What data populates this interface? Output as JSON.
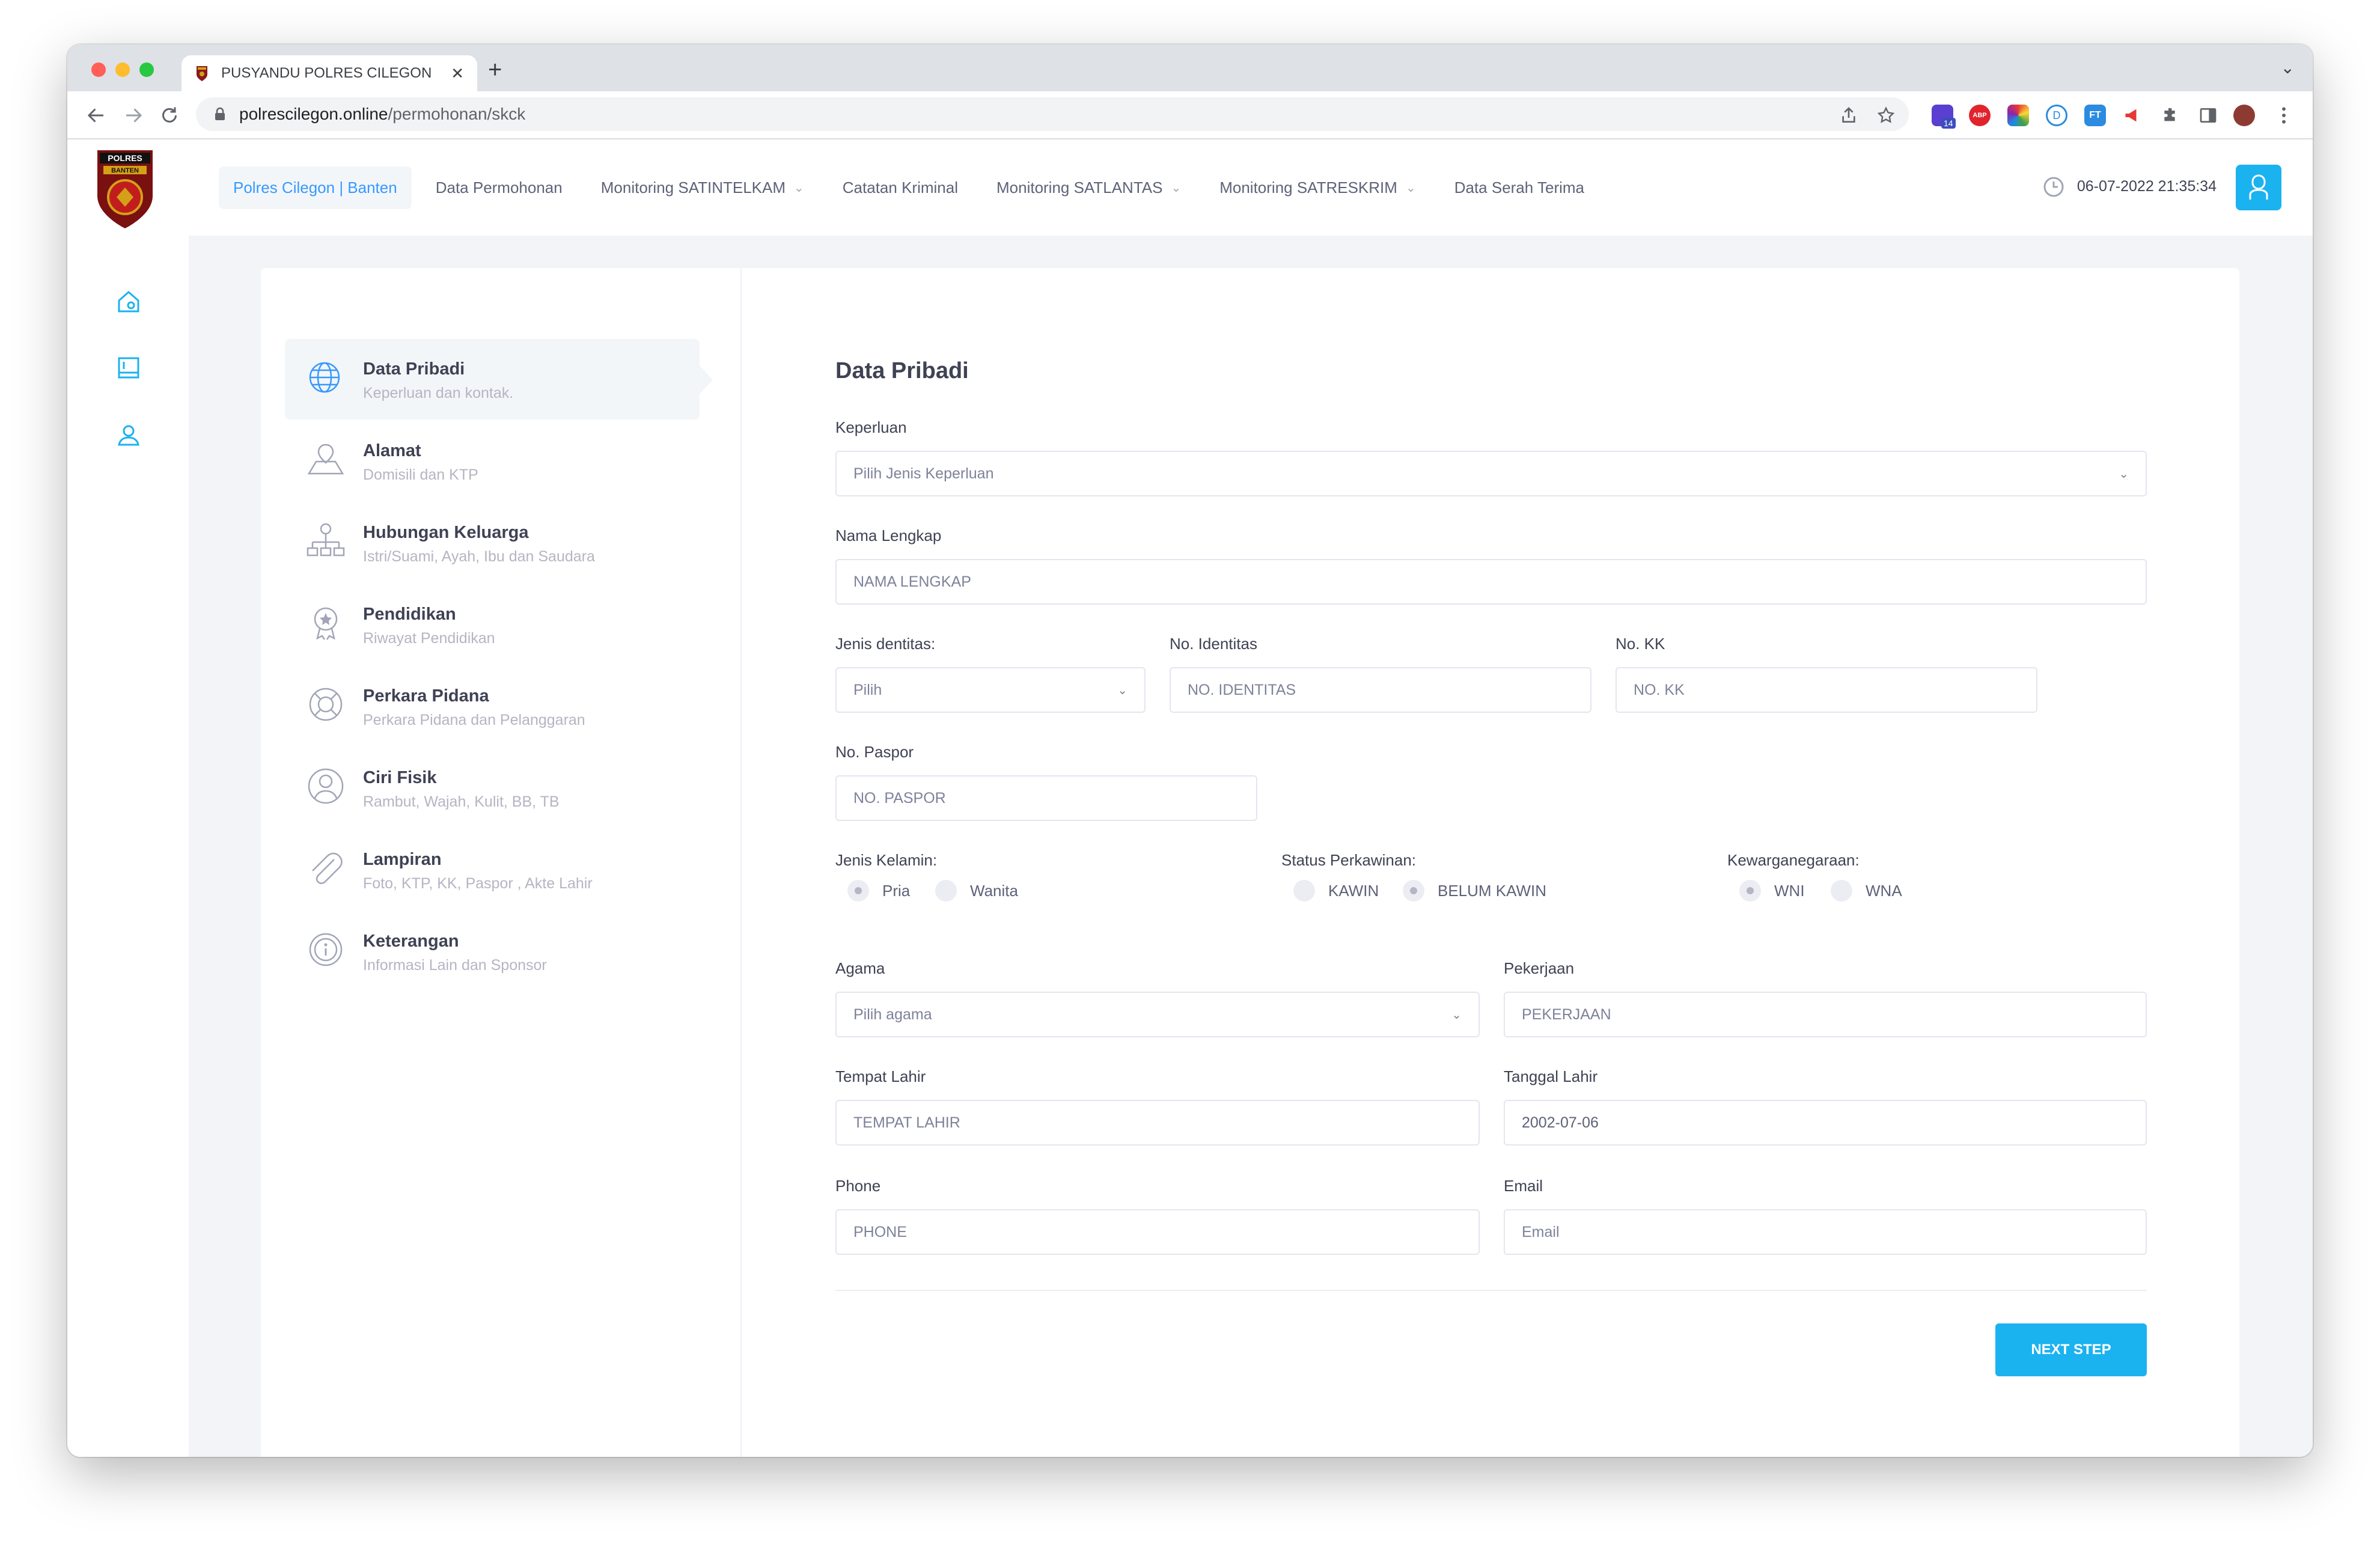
{
  "browser": {
    "tab_title": "PUSYANDU POLRES CILEGON",
    "tab_close": "✕",
    "new_tab": "+",
    "tab_menu": "⌄",
    "url_host": "polrescilegon.online",
    "url_path": "/permohonan/skck",
    "ext_badge": "14",
    "ext_abp": "ABP",
    "ext_d": "D",
    "ext_ft": "FT"
  },
  "topnav": {
    "items": [
      {
        "label": "Polres Cilegon | Banten",
        "active": true
      },
      {
        "label": "Data Permohonan"
      },
      {
        "label": "Monitoring SATINTELKAM",
        "dropdown": true
      },
      {
        "label": "Catatan Kriminal"
      },
      {
        "label": "Monitoring SATLANTAS",
        "dropdown": true
      },
      {
        "label": "Monitoring SATRESKRIM",
        "dropdown": true
      },
      {
        "label": "Data Serah Terima"
      }
    ],
    "datetime": "06-07-2022 21:35:34"
  },
  "logo": {
    "top_text": "POLRES",
    "sub_text": "BANTEN"
  },
  "steps": [
    {
      "title": "Data Pribadi",
      "desc": "Keperluan dan kontak.",
      "icon": "globe-icon"
    },
    {
      "title": "Alamat",
      "desc": "Domisili dan KTP",
      "icon": "map-icon"
    },
    {
      "title": "Hubungan Keluarga",
      "desc": "Istri/Suami, Ayah, Ibu dan Saudara",
      "icon": "org-chart-icon"
    },
    {
      "title": "Pendidikan",
      "desc": "Riwayat Pendidikan",
      "icon": "badge-icon"
    },
    {
      "title": "Perkara Pidana",
      "desc": "Perkara Pidana dan Pelanggaran",
      "icon": "lifebuoy-icon"
    },
    {
      "title": "Ciri Fisik",
      "desc": "Rambut, Wajah, Kulit, BB, TB",
      "icon": "user-circle-icon"
    },
    {
      "title": "Lampiran",
      "desc": "Foto, KTP, KK, Paspor , Akte Lahir",
      "icon": "paperclip-icon"
    },
    {
      "title": "Keterangan",
      "desc": "Informasi Lain dan Sponsor",
      "icon": "info-icon"
    }
  ],
  "form": {
    "title": "Data Pribadi",
    "keperluan": {
      "label": "Keperluan",
      "value": "Pilih Jenis Keperluan"
    },
    "nama": {
      "label": "Nama Lengkap",
      "placeholder": "NAMA LENGKAP"
    },
    "jenis_identitas": {
      "label": "Jenis dentitas:",
      "value": "Pilih"
    },
    "no_identitas": {
      "label": "No. Identitas",
      "placeholder": "NO. IDENTITAS"
    },
    "no_kk": {
      "label": "No. KK",
      "placeholder": "NO. KK"
    },
    "no_paspor": {
      "label": "No. Paspor",
      "placeholder": "NO. PASPOR"
    },
    "jenis_kelamin": {
      "label": "Jenis Kelamin:",
      "options": [
        "Pria",
        "Wanita"
      ],
      "selected": "Pria"
    },
    "status": {
      "label": "Status Perkawinan:",
      "options": [
        "KAWIN",
        "BELUM KAWIN"
      ],
      "selected": "BELUM KAWIN"
    },
    "kewarganegaraan": {
      "label": "Kewarganegaraan:",
      "options": [
        "WNI",
        "WNA"
      ],
      "selected": "WNI"
    },
    "agama": {
      "label": "Agama",
      "value": "Pilih agama"
    },
    "pekerjaan": {
      "label": "Pekerjaan",
      "placeholder": "PEKERJAAN"
    },
    "tempat_lahir": {
      "label": "Tempat Lahir",
      "placeholder": "TEMPAT LAHIR"
    },
    "tanggal_lahir": {
      "label": "Tanggal Lahir",
      "value": "2002-07-06"
    },
    "phone": {
      "label": "Phone",
      "placeholder": "PHONE"
    },
    "email": {
      "label": "Email",
      "placeholder": "Email"
    },
    "next_label": "NEXT STEP"
  },
  "colors": {
    "accent": "#1bb2f0",
    "nav_active": "#3699ff",
    "page_bg": "#f3f4f7"
  }
}
